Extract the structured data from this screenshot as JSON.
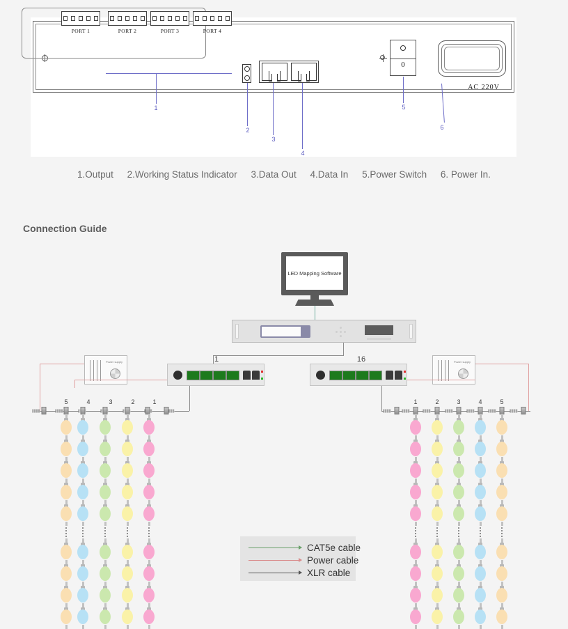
{
  "rear_panel": {
    "ports": [
      {
        "label": "PORT 1",
        "pins": 5
      },
      {
        "label": "PORT 2",
        "pins": 5
      },
      {
        "label": "PORT 3",
        "pins": 5
      },
      {
        "label": "PORT 4",
        "pins": 5
      }
    ],
    "power_switch": {
      "on_mark": "O",
      "off_mark": "0"
    },
    "ac_label": "AC  220V",
    "callouts": [
      {
        "num": "1"
      },
      {
        "num": "2"
      },
      {
        "num": "3"
      },
      {
        "num": "4"
      },
      {
        "num": "5"
      },
      {
        "num": "6"
      }
    ]
  },
  "legend_items": [
    "1.Output",
    "2.Working Status Indicator",
    "3.Data Out",
    "4.Data In",
    "5.Power Switch",
    "6. Power In."
  ],
  "connection_guide": {
    "title": "Connection Guide",
    "monitor_label": "LED Mapping Software",
    "decoder_left_num": "1",
    "decoder_right_num": "16",
    "psu_label": "Power supply",
    "strand_numbers_left": [
      "5",
      "4",
      "3",
      "2",
      "1"
    ],
    "strand_numbers_right": [
      "1",
      "2",
      "3",
      "4",
      "5"
    ],
    "strand_colors_left": [
      "#fadfb2",
      "#b7e1f5",
      "#cbe8ae",
      "#faf2a8",
      "#f9a8d0"
    ],
    "strand_colors_right": [
      "#f9a8d0",
      "#faf2a8",
      "#cbe8ae",
      "#b7e1f5",
      "#fadfb2"
    ],
    "cable_legend": [
      {
        "label": "CAT5e cable",
        "color": "#6aa06a"
      },
      {
        "label": "Power cable",
        "color": "#d98c8c"
      },
      {
        "label": "XLR cable",
        "color": "#555555"
      }
    ]
  },
  "colors": {
    "page_bg": "#f4f4f4",
    "callout_blue": "#6e6ec8",
    "cat5e": "#6aa06a",
    "power": "#e0a0a0",
    "xlr": "#8d8d8d"
  }
}
